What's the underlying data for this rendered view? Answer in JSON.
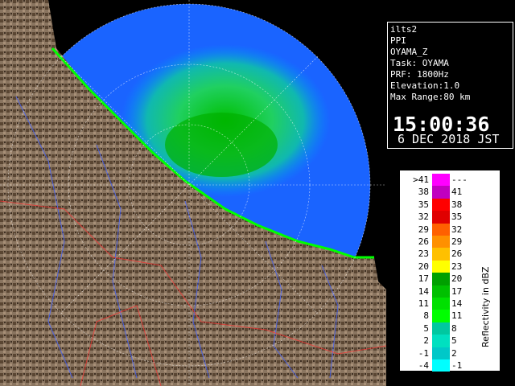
{
  "info": {
    "product": "ilts2",
    "scan": "PPI",
    "field": "OYAMA_Z",
    "task": "Task: OYAMA",
    "prf": "PRF: 1800Hz",
    "elevation": "Elevation:1.0",
    "range": "Max Range:80 km",
    "time": "15:00:36",
    "date": "6 DEC 2018 JST"
  },
  "legend": {
    "unit": "Reflectivity in dBZ",
    "rows": [
      {
        "low": ">41",
        "high": "---",
        "color": "#ff00ff"
      },
      {
        "low": "38",
        "high": "41",
        "color": "#c000c0"
      },
      {
        "low": "35",
        "high": "38",
        "color": "#ff0000"
      },
      {
        "low": "32",
        "high": "35",
        "color": "#e00000"
      },
      {
        "low": "29",
        "high": "32",
        "color": "#ff6000"
      },
      {
        "low": "26",
        "high": "29",
        "color": "#ff9000"
      },
      {
        "low": "23",
        "high": "26",
        "color": "#ffc000"
      },
      {
        "low": "20",
        "high": "23",
        "color": "#ffff00"
      },
      {
        "low": "17",
        "high": "20",
        "color": "#00a000"
      },
      {
        "low": "14",
        "high": "17",
        "color": "#00c000"
      },
      {
        "low": "11",
        "high": "14",
        "color": "#00e000"
      },
      {
        "low": "8",
        "high": "11",
        "color": "#00ff00"
      },
      {
        "low": "5",
        "high": "8",
        "color": "#00c8a0"
      },
      {
        "low": "2",
        "high": "5",
        "color": "#00e0c0"
      },
      {
        "low": "-1",
        "high": "2",
        "color": "#00c8c8"
      },
      {
        "low": "-4",
        "high": "-1",
        "color": "#00ffff"
      }
    ]
  },
  "colors": {
    "sea": "#1a64ff",
    "land": "#8a7560",
    "background": "#000000"
  }
}
